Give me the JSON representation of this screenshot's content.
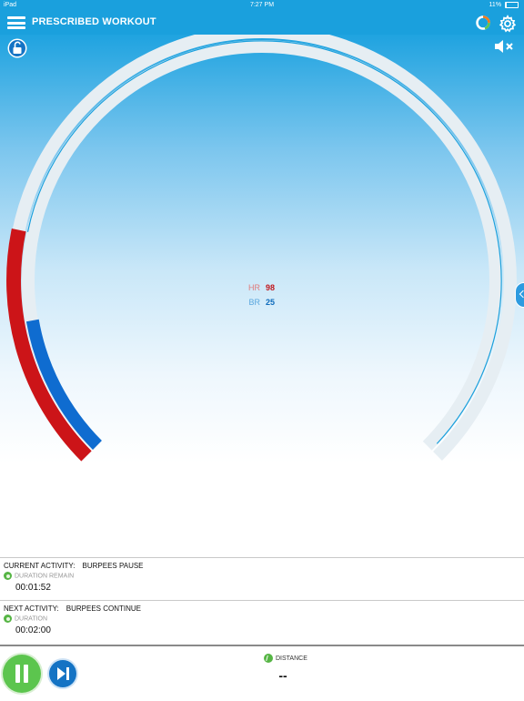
{
  "status_bar": {
    "device": "iPad",
    "time": "7:27 PM",
    "battery": "11%"
  },
  "header": {
    "title": "PRESCRIBED WORKOUT"
  },
  "readings": {
    "hr_label": "HR",
    "hr_value": "98",
    "br_label": "BR",
    "br_value": "25"
  },
  "gauge": {
    "hr_fraction": 0.21,
    "br_fraction": 0.13,
    "colors": {
      "hr": "#cc1418",
      "br": "#0f6cd0",
      "track": "#e6eef3",
      "accent": "#1aa0dd"
    }
  },
  "current_activity": {
    "heading": "CURRENT ACTIVITY:",
    "name": "BURPEES PAUSE",
    "sub_label": "DURATION REMAIN",
    "time": "00:01:52"
  },
  "next_activity": {
    "heading": "NEXT ACTIVITY:",
    "name": "BURPEES CONTINUE",
    "sub_label": "DURATION",
    "time": "00:02:00"
  },
  "distance": {
    "label": "DISTANCE",
    "value": "--"
  },
  "icons": {
    "menu": "menu-icon",
    "progress": "progress-ring-icon",
    "settings": "gear-icon",
    "lock": "unlock-icon",
    "sound": "mute-icon",
    "pause": "pause-icon",
    "skip": "skip-next-icon",
    "distance": "distance-icon"
  }
}
